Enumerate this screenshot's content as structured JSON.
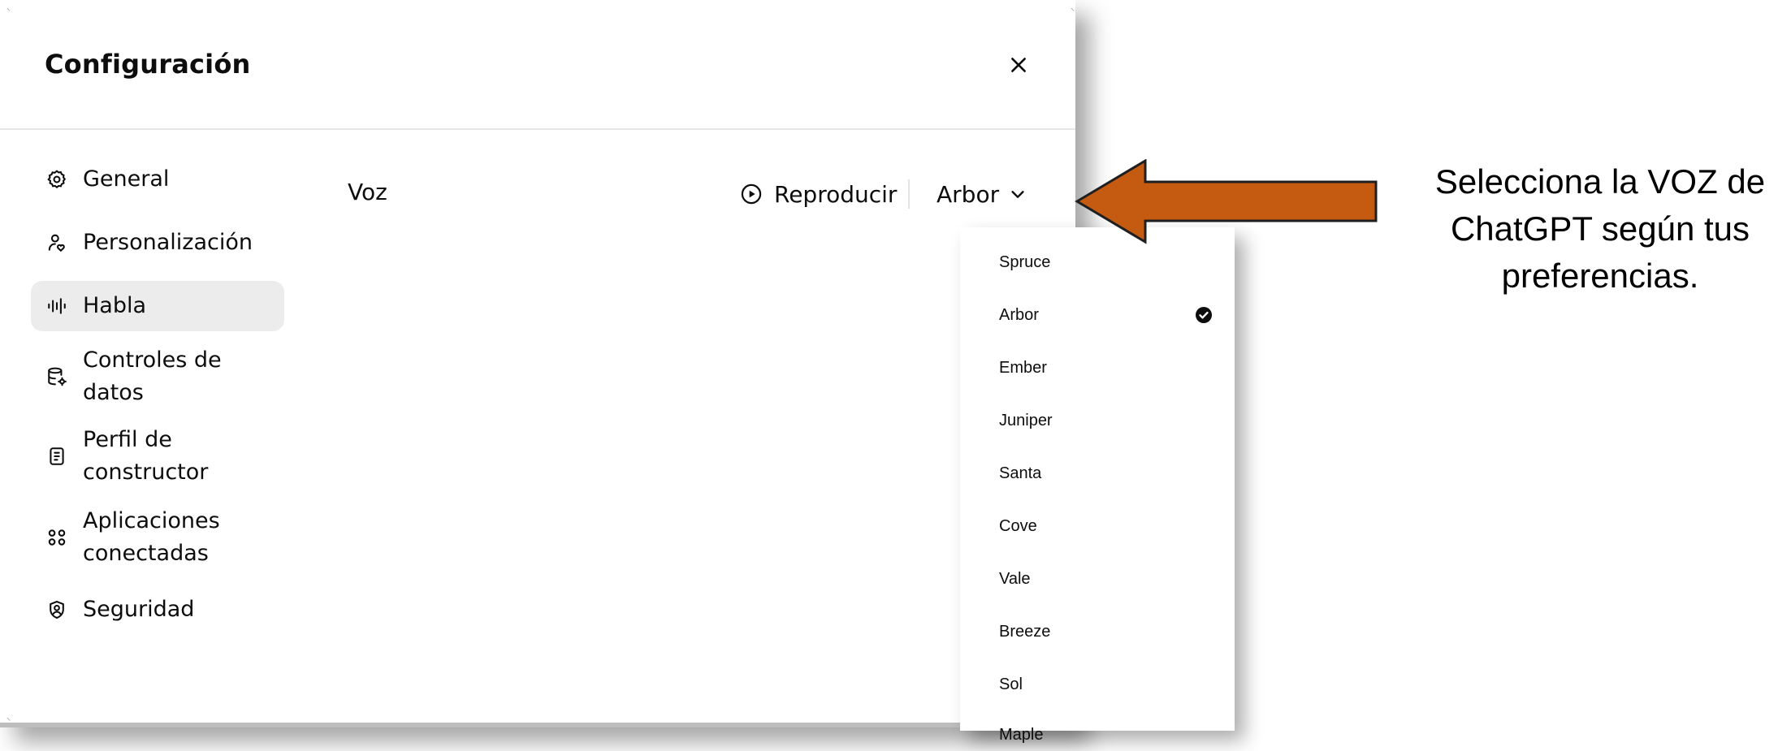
{
  "dialog": {
    "title": "Configuración"
  },
  "sidebar": {
    "items": [
      {
        "label": "General",
        "icon": "gear-icon"
      },
      {
        "label": "Personalización",
        "icon": "person-heart-icon"
      },
      {
        "label": "Habla",
        "icon": "waveform-icon",
        "active": true
      },
      {
        "label": "Controles de datos",
        "icon": "database-gear-icon"
      },
      {
        "label_lines": [
          "Perfil de",
          "constructor"
        ],
        "icon": "id-card-icon"
      },
      {
        "label_lines": [
          "Aplicaciones",
          "conectadas"
        ],
        "icon": "grid-circles-icon"
      },
      {
        "label": "Seguridad",
        "icon": "shield-user-icon"
      }
    ]
  },
  "speech": {
    "voice_label": "Voz",
    "play_label": "Reproducir",
    "selected_voice": "Arbor"
  },
  "voice_options": [
    "Spruce",
    "Arbor",
    "Ember",
    "Juniper",
    "Santa",
    "Cove",
    "Vale",
    "Breeze",
    "Sol",
    "Maple"
  ],
  "annotation": {
    "text": "Selecciona la VOZ de ChatGPT según tus preferencias.",
    "arrow_color": "#c55a11"
  }
}
